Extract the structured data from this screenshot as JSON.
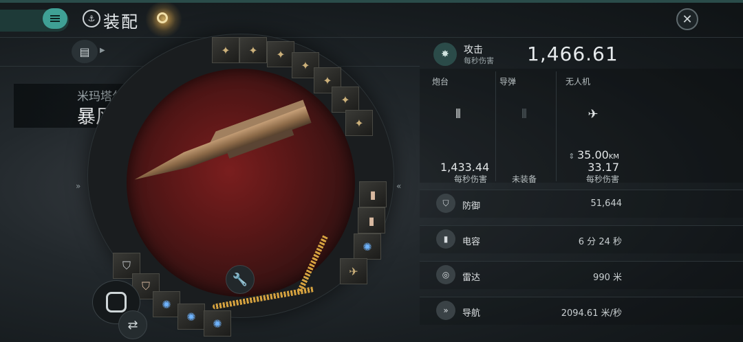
{
  "header": {
    "title": "装配",
    "menu_icon": "menu-icon",
    "close_icon": "close-icon",
    "target_icon": "target-icon"
  },
  "ship": {
    "faction": "米玛塔尔",
    "class": "暴风级",
    "chevron": "»"
  },
  "attack": {
    "title": "攻击",
    "subtitle": "每秒伤害",
    "value": "1,466.61"
  },
  "weapons": [
    {
      "label": "炮台",
      "value": "1,433.44",
      "unit": "每秒伤害",
      "status": "equipped"
    },
    {
      "label": "导弹",
      "value": "",
      "unit": "未装备",
      "status": "empty"
    },
    {
      "label": "无人机",
      "range": "35.00",
      "range_unit": "KM",
      "value": "33.17",
      "unit": "每秒伤害",
      "status": "equipped"
    }
  ],
  "stats": [
    {
      "icon": "shield-icon",
      "label": "防御",
      "value": "51,644"
    },
    {
      "icon": "capacitor-icon",
      "label": "电容",
      "value": "6 分 24 秒"
    },
    {
      "icon": "radar-icon",
      "label": "雷达",
      "value": "990 米"
    },
    {
      "icon": "navigation-icon",
      "label": "导航",
      "value": "2094.61 米/秒"
    }
  ],
  "side_arrows": {
    "left": "»",
    "right": "«"
  },
  "colors": {
    "accent": "#3fa095",
    "fitting_ring_highlight": "#d6a23f",
    "ship_backdrop": "#5a1717"
  }
}
